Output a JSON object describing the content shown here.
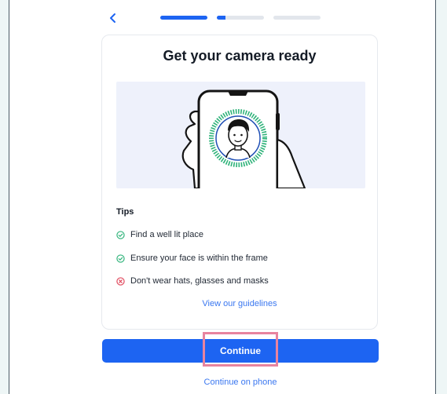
{
  "header": {
    "back_icon": "chevron-left-icon",
    "progress": [
      1.0,
      0.18,
      0.0
    ]
  },
  "card": {
    "title": "Get your camera ready",
    "tips_heading": "Tips",
    "tips": [
      {
        "text": "Find a well lit place",
        "status": "ok",
        "icon": "check-circle-icon"
      },
      {
        "text": "Ensure your face is within the frame",
        "status": "ok",
        "icon": "check-circle-icon"
      },
      {
        "text": "Don't wear hats, glasses and masks",
        "status": "bad",
        "icon": "x-circle-icon"
      }
    ],
    "guidelines_link": "View our guidelines"
  },
  "actions": {
    "continue_label": "Continue",
    "phone_link": "Continue on phone"
  },
  "colors": {
    "accent": "#1d64f2",
    "success": "#2fb37a",
    "error": "#e0475b",
    "highlight": "#e7839f"
  }
}
